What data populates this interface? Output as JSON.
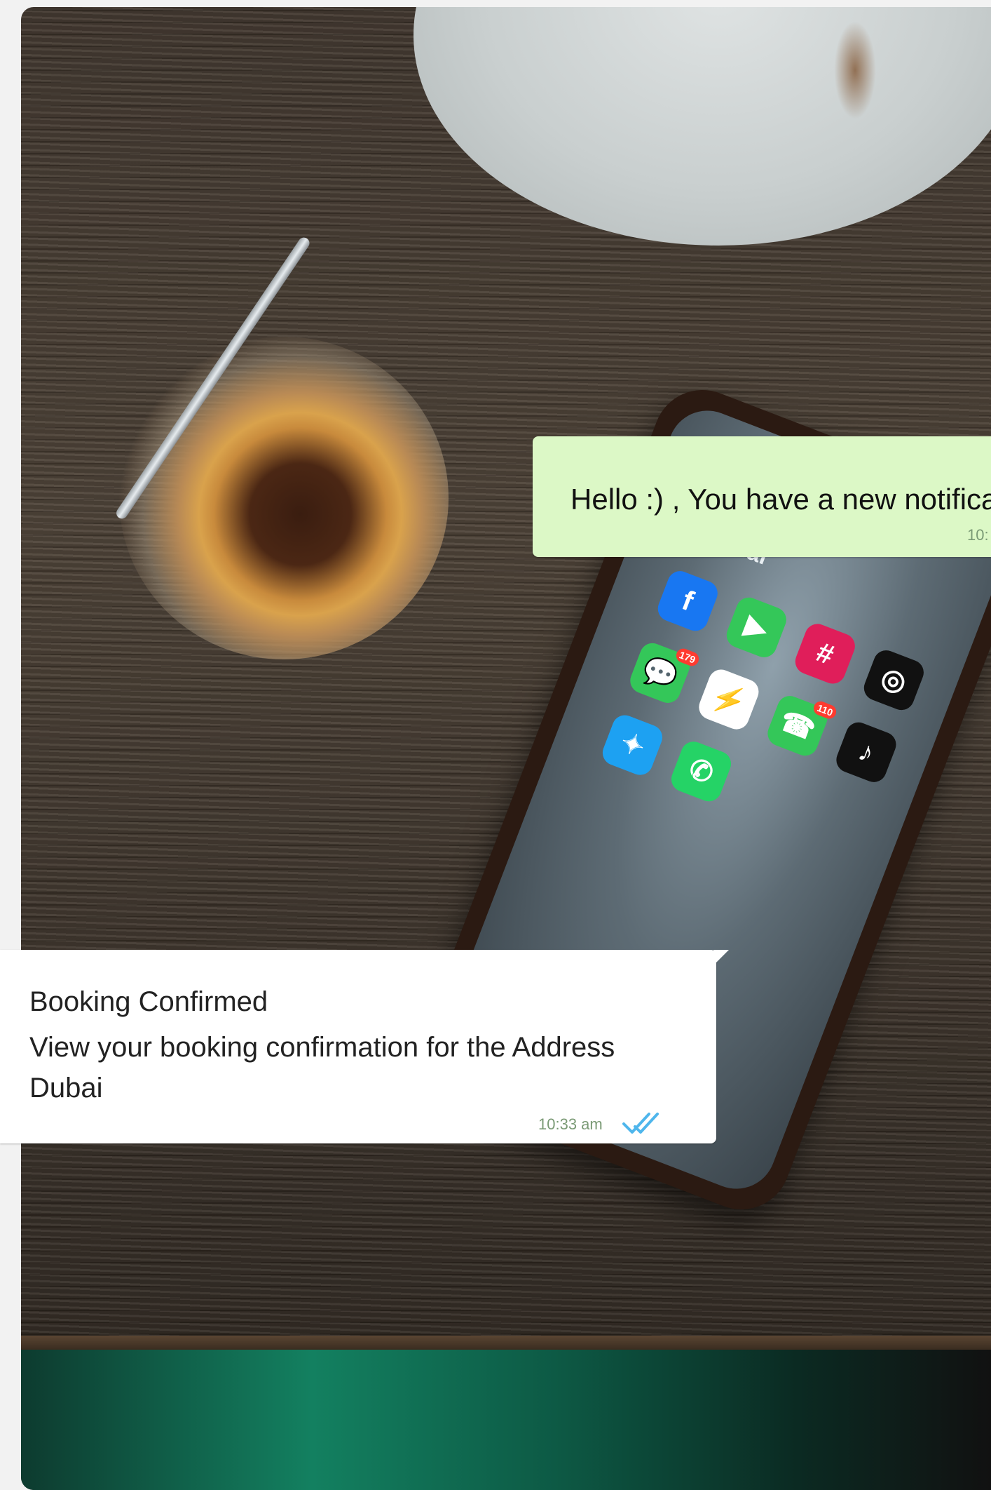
{
  "messages": {
    "outgoing": {
      "text": "Hello :) , You have a new notificat",
      "time": "10:"
    },
    "incoming": {
      "title": "Booking Confirmed",
      "body": "View your booking confirmation for the Address Dubai",
      "time": "10:33 am",
      "status_icon": "double-check-icon"
    }
  },
  "photo": {
    "phone_folder_label": "Social",
    "badges": [
      "179",
      "110"
    ]
  },
  "colors": {
    "outgoing_bubble": "#dcf8c6",
    "incoming_bubble": "#ffffff",
    "timestamp": "#7a9a75",
    "read_check": "#4fb6ec"
  }
}
